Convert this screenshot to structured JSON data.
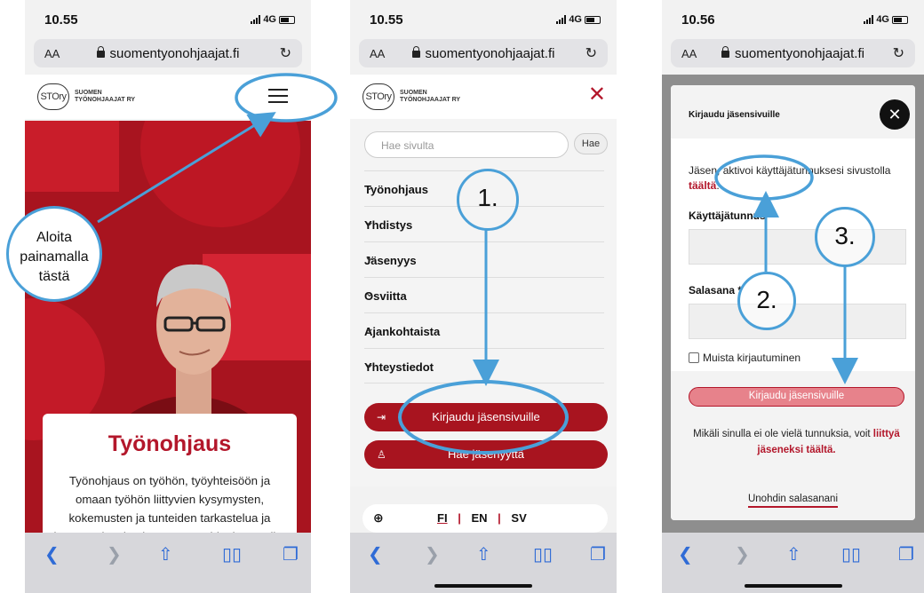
{
  "status": {
    "p1_time": "10.55",
    "p2_time": "10.55",
    "p3_time": "10.56",
    "network": "4G"
  },
  "browser": {
    "aa_label": "AA",
    "domain": "suomentyonohjaajat.fi"
  },
  "site": {
    "logo_mark": "STOry",
    "logo_line1": "SUOMEN",
    "logo_line2": "TYÖNOHJAAJAT RY"
  },
  "phone1": {
    "card_title": "Työnohjaus",
    "card_text": "Työnohjaus on työhön, työyhteisöön ja omaan työhön liittyvien kysymysten, kokemusten ja tunteiden tarkastelua ja jäsentämistä koulutetun työnohjaajan avulla. Työnohjauksen tavoitteena on",
    "annotation": "Aloita painamalla tästä"
  },
  "phone2": {
    "search_placeholder": "Hae sivulta",
    "search_button": "Hae",
    "menu_items": [
      "Työnohjaus",
      "Yhdistys",
      "Jäsenyys",
      "Osviitta",
      "Ajankohtaista",
      "Yhteystiedot"
    ],
    "login_button": "Kirjaudu jäsensivuille",
    "join_button": "Hae jäsenyyttä",
    "languages": [
      "FI",
      "EN",
      "SV"
    ],
    "step1": "1."
  },
  "phone3": {
    "modal_title": "Kirjaudu jäsensivuille",
    "intro_text": "Jäsen, aktivoi käyttäjätunnuksesi sivustolla",
    "intro_link": "täältä",
    "username_label": "Käyttäjätunnus *",
    "password_label": "Salasana *",
    "remember_label": "Muista kirjautuminen",
    "login_button": "Kirjaudu jäsensivuille",
    "note_text": "Mikäli sinulla ei ole vielä tunnuksia, voit",
    "note_link": "liittyä jäseneksi täältä.",
    "forgot_link": "Unohdin salasanani",
    "step2": "2.",
    "step3": "3."
  },
  "colors": {
    "brand_red": "#a8141f",
    "annotation_blue": "#4aa0d8",
    "safari_blue": "#2f6bd6"
  }
}
